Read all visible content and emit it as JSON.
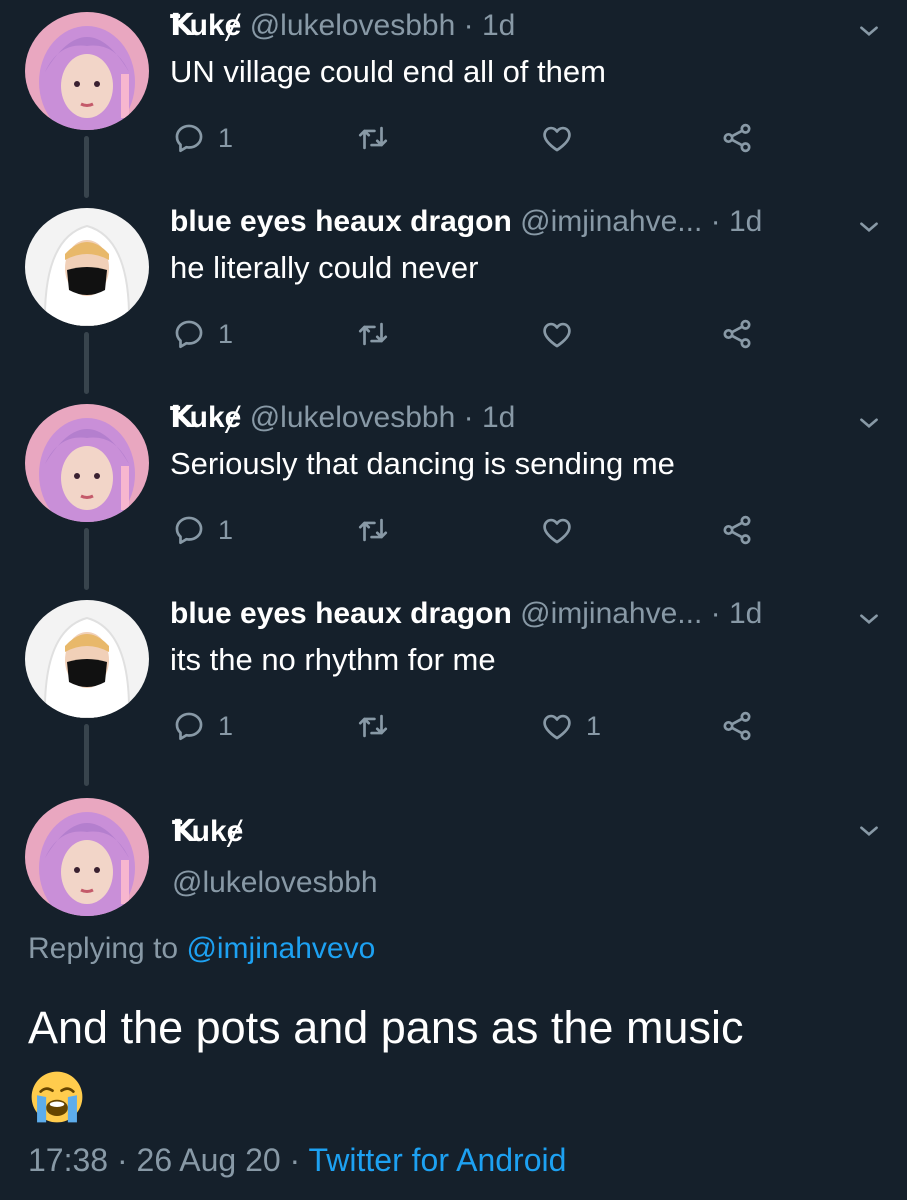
{
  "thread": [
    {
      "name": "Ꝁukɇ",
      "handle": "@lukelovesbbh",
      "time": "1d",
      "text": "UN village could end all of them",
      "replies": "1",
      "retweets": "",
      "likes": "",
      "avatar": "pink-hair-avatar"
    },
    {
      "name": "blue eyes heaux dragon",
      "handle": "@imjinahve...",
      "time": "1d",
      "text": "he literally could never",
      "replies": "1",
      "retweets": "",
      "likes": "",
      "avatar": "white-hood-mask-avatar"
    },
    {
      "name": "Ꝁukɇ",
      "handle": "@lukelovesbbh",
      "time": "1d",
      "text": "Seriously that dancing is sending me",
      "replies": "1",
      "retweets": "",
      "likes": "",
      "avatar": "pink-hair-avatar"
    },
    {
      "name": "blue eyes heaux dragon",
      "handle": "@imjinahve...",
      "time": "1d",
      "text": "its the no rhythm for me",
      "replies": "1",
      "retweets": "",
      "likes": "1",
      "avatar": "white-hood-mask-avatar"
    }
  ],
  "main": {
    "name": "Ꝁukɇ",
    "handle": "@lukelovesbbh",
    "replying_prefix": "Replying to",
    "replying_to": "@imjinahvevo",
    "text": "And the pots and pans as the music",
    "emoji": "loudly-crying-face",
    "time": "17:38",
    "date": "26 Aug 20",
    "source": "Twitter for Android",
    "separator": "·"
  },
  "colors": {
    "background": "#15202b",
    "secondary_text": "#8899a6",
    "link": "#1da1f2",
    "thread_line": "#38444d"
  }
}
